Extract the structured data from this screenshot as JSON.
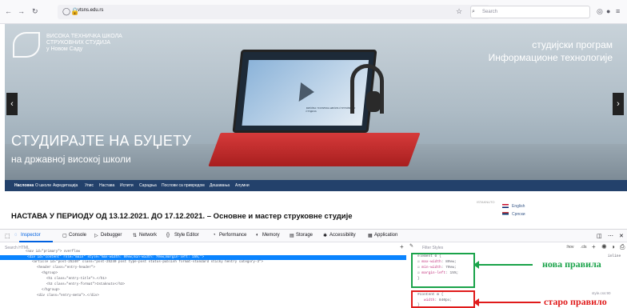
{
  "browser": {
    "url": "vtsns.edu.rs",
    "search_placeholder": "Search"
  },
  "hero": {
    "logo_lines": [
      "ВИСОКА ТЕХНИЧКА ШКОЛА",
      "СТРУКОВНИХ СТУДИЈА",
      "у Новом Саду"
    ],
    "program_line1": "студијски програм",
    "program_line2": "Информационе технологије",
    "slogan_line1": "СТУДИРАЈТЕ НА БУЏЕТУ",
    "slogan_line2": "на државној високој школи",
    "screen_text": "ВИСОКА ТЕХНИЧКА ШКОЛА СТРУКОВНИХ СТУДИЈА"
  },
  "menu": {
    "items": [
      "Насловна",
      "О школи",
      "Акредитација",
      "Упис",
      "Настава",
      "Испити",
      "Сарадња",
      "Послови са привредом",
      "Дешавања",
      "Алумни"
    ]
  },
  "content": {
    "title": "НАСТАВА У ПЕРИОДУ ОД 13.12.2021. ДО 17.12.2021. – Основне и мастер струковне студије",
    "badge": "ISTAKNUTO",
    "lang_en": "English",
    "lang_sr": "Српски"
  },
  "devtools": {
    "tabs": [
      "Inspector",
      "Console",
      "Debugger",
      "Network",
      "Style Editor",
      "Performance",
      "Memory",
      "Storage",
      "Accessibility",
      "Application"
    ],
    "search_placeholder": "Search HTML",
    "filter_placeholder": "Filter Styles",
    "code_lines": [
      "<nav id=\"primary\"> overflow",
      "<div id=\"content\" role=\"main\" style=\"max-width: 80vw;min-width: 70vw;margin-left: 15%;\">",
      "<article id=\"post-25240\" class=\"post-25240 post type-post status-publish format-standard sticky hentry category-3\">",
      "<header class=\"entry-header\">",
      "<hgroup>",
      "<h1 class=\"entry-title\">…</h1>",
      "<h3 class=\"entry-format\">Istaknuto</h3>",
      "</hgroup>",
      "<div class=\"entry-meta\">…</div>"
    ],
    "element_rule": {
      "selector": "element",
      "props": [
        {
          "name": "max-width",
          "value": "80vw;"
        },
        {
          "name": "min-width",
          "value": "70vw;"
        },
        {
          "name": "margin-left",
          "value": "15%;"
        }
      ]
    },
    "content_rule": {
      "selector": "#content",
      "props": [
        {
          "name": "width",
          "value": "840px;"
        }
      ],
      "file": "style.css:90"
    },
    "inline_label": "inline",
    "label_new": "нова правила",
    "label_old": "старо правило"
  }
}
